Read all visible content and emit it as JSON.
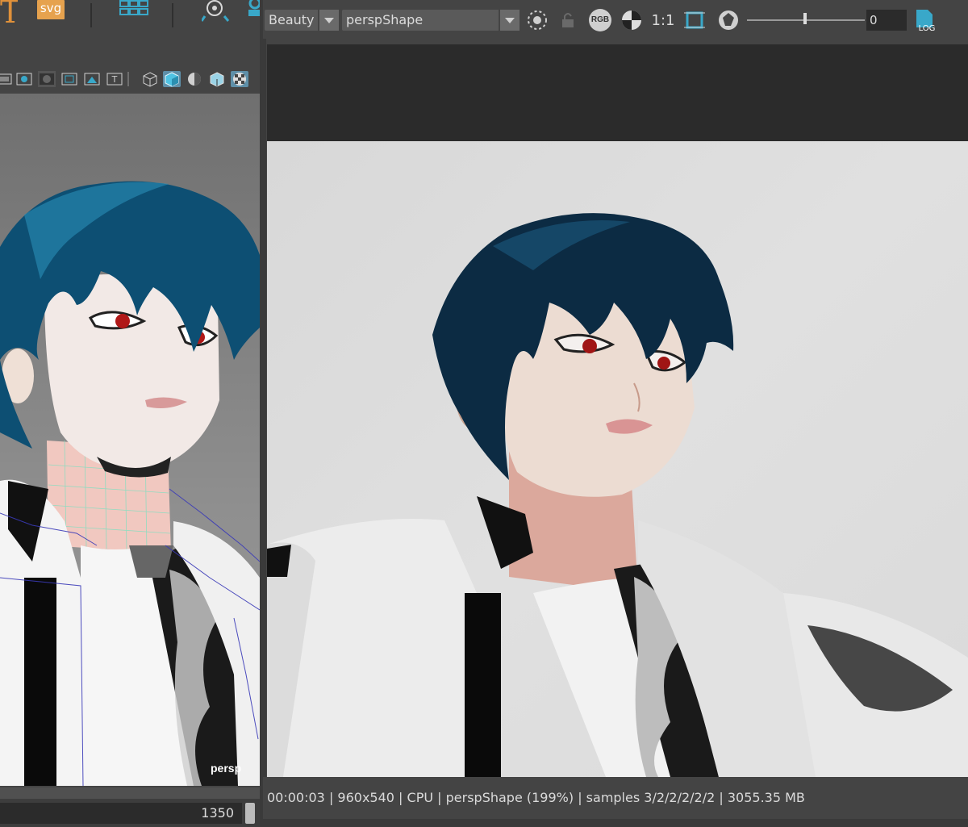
{
  "shelf": {
    "svg_label": "svg",
    "icons": [
      "text-tool-icon",
      "svg-icon",
      "grid-icon",
      "light-icon",
      "camera-icon"
    ]
  },
  "viewport": {
    "camera_label": "persp",
    "toolbar_icons": [
      "film-gate-icon",
      "resolution-gate-icon",
      "gate-mask-icon",
      "field-chart-icon",
      "safe-action-icon",
      "safe-title-icon",
      "wireframe-icon",
      "smooth-shade-icon",
      "shade-default-icon",
      "wireframe-on-shaded-icon",
      "textured-icon"
    ],
    "frame_value": "1350"
  },
  "render_view": {
    "aov_select": "Beauty",
    "camera_select": "perspShape",
    "snapshot_ratio": "1:1",
    "channel_button": "RGB",
    "exposure_value": "0",
    "log_label": "LOG",
    "status_text": "00:00:03 | 960x540 | CPU | perspShape (199%) | samples 3/2/2/2/2/2 | 3055.35 MB"
  },
  "colors": {
    "ui_background": "#444444",
    "accent_blue": "#39a8c9",
    "shelf_orange": "#e6a24e",
    "hair_blue": "#0d4f73",
    "eye_red": "#b01818"
  }
}
